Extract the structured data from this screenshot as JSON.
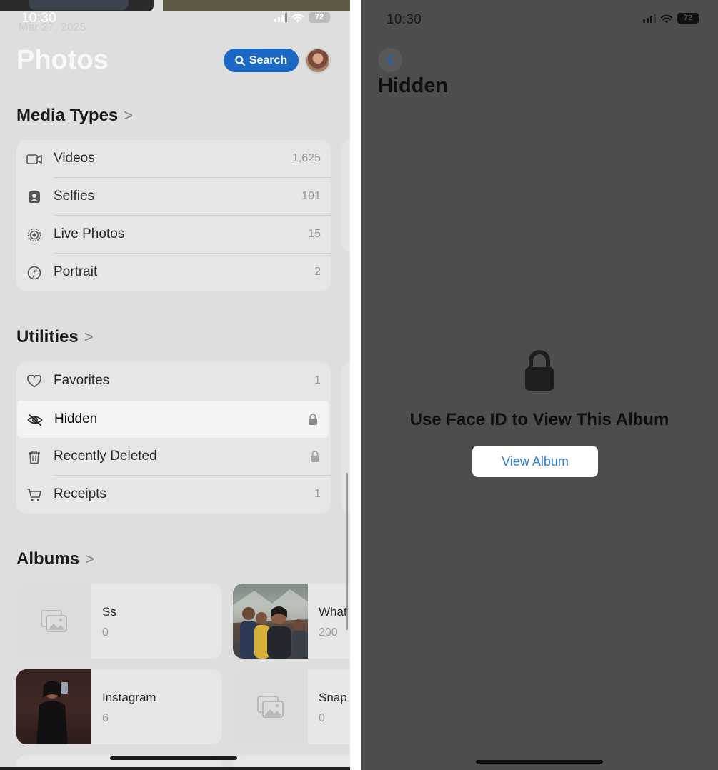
{
  "left": {
    "status_time": "10:30",
    "status_date": "Mar 27, 2025",
    "battery": "72",
    "title": "Photos",
    "search_label": "Search",
    "media_types": {
      "title": "Media Types",
      "items": [
        {
          "label": "Videos",
          "count": "1,625",
          "icon": "video-icon"
        },
        {
          "label": "Selfies",
          "count": "191",
          "icon": "selfie-icon"
        },
        {
          "label": "Live Photos",
          "count": "15",
          "icon": "live-photo-icon"
        },
        {
          "label": "Portrait",
          "count": "2",
          "icon": "portrait-icon"
        }
      ]
    },
    "utilities": {
      "title": "Utilities",
      "items": [
        {
          "label": "Favorites",
          "count": "1",
          "icon": "heart-icon"
        },
        {
          "label": "Hidden",
          "count": "",
          "icon": "eye-slash-icon",
          "locked": true,
          "highlighted": true
        },
        {
          "label": "Recently Deleted",
          "count": "",
          "icon": "trash-icon",
          "locked": true
        },
        {
          "label": "Receipts",
          "count": "1",
          "icon": "cart-icon"
        }
      ]
    },
    "albums": {
      "title": "Albums",
      "items": [
        {
          "name": "Ss",
          "count": "0"
        },
        {
          "name": "What",
          "count": "200"
        },
        {
          "name": "Instagram",
          "count": "6"
        },
        {
          "name": "Snap",
          "count": "0"
        }
      ]
    }
  },
  "right": {
    "status_time": "10:30",
    "battery": "72",
    "title": "Hidden",
    "message": "Use Face ID to View This Album",
    "button_label": "View Album"
  },
  "colors": {
    "accent_blue": "#1a67c4",
    "link_blue": "#2b79d8",
    "dim_overlay_left": "#dedede",
    "dim_overlay_right": "#4d4d4d"
  }
}
